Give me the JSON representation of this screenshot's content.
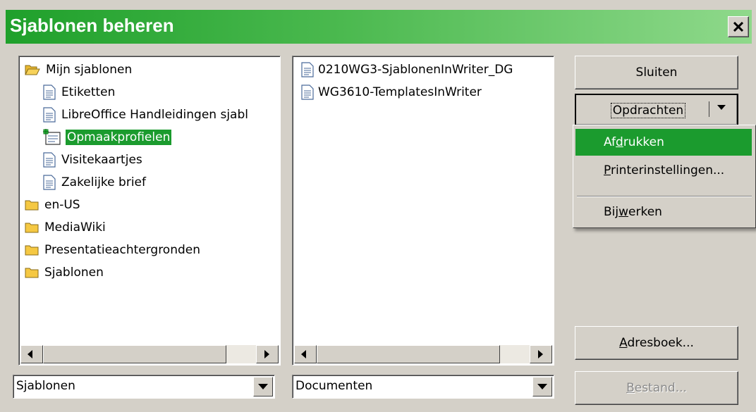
{
  "window": {
    "title": "Sjablonen beheren"
  },
  "left_tree": {
    "items": [
      {
        "label": "Mijn sjablonen",
        "icon": "folder-open-icon",
        "level": 0
      },
      {
        "label": "Etiketten",
        "icon": "document-icon",
        "level": 1
      },
      {
        "label": "LibreOffice Handleidingen sjabl",
        "icon": "document-icon",
        "level": 1
      },
      {
        "label": "Opmaakprofielen",
        "icon": "styles-icon",
        "level": 1,
        "selected": true
      },
      {
        "label": "Visitekaartjes",
        "icon": "document-icon",
        "level": 1
      },
      {
        "label": "Zakelijke brief",
        "icon": "document-icon",
        "level": 1
      },
      {
        "label": "en-US",
        "icon": "folder-icon",
        "level": 0
      },
      {
        "label": "MediaWiki",
        "icon": "folder-icon",
        "level": 0
      },
      {
        "label": "Presentatieachtergronden",
        "icon": "folder-icon",
        "level": 0
      },
      {
        "label": "Sjablonen",
        "icon": "folder-icon",
        "level": 0
      }
    ]
  },
  "right_list": {
    "items": [
      {
        "label": "0210WG3-SjablonenInWriter_DG",
        "icon": "document-icon"
      },
      {
        "label": "WG3610-TemplatesInWriter",
        "icon": "document-icon"
      }
    ]
  },
  "left_combo": {
    "value": "Sjablonen"
  },
  "right_combo": {
    "value": "Documenten"
  },
  "buttons": {
    "close": "Sluiten",
    "commands": "Opdrachten",
    "address_book_pre": "",
    "address_book_u": "A",
    "address_book_post": "dresboek...",
    "file_pre": "",
    "file_u": "B",
    "file_post": "estand..."
  },
  "menu": {
    "print_pre": "Af",
    "print_u": "d",
    "print_post": "rukken",
    "printer_pre": "",
    "printer_u": "P",
    "printer_post": "rinterinstellingen...",
    "update_pre": "Bij",
    "update_u": "w",
    "update_post": "erken"
  },
  "colors": {
    "title_gradient_start": "#1fa02b",
    "selection": "#1b9b2e"
  }
}
